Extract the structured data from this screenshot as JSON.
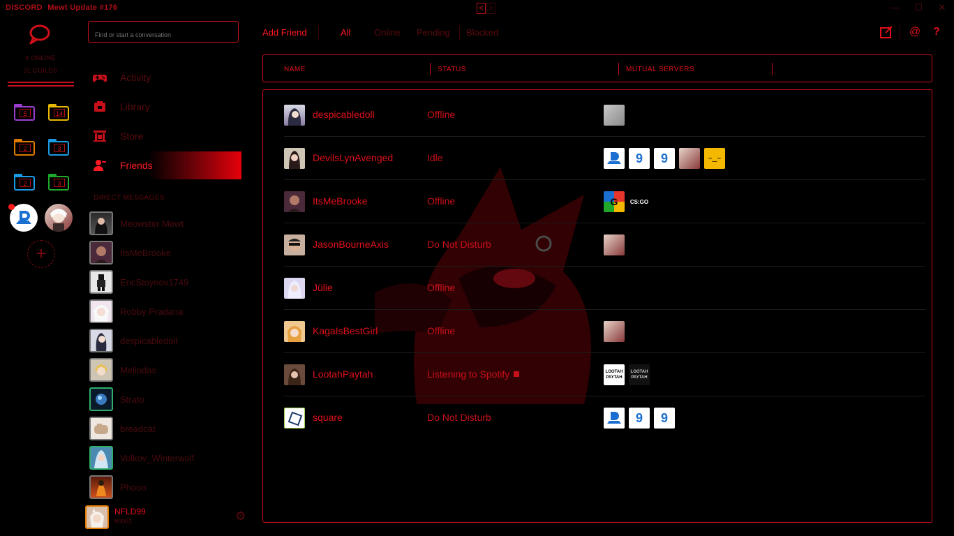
{
  "titlebar": {
    "logo": "DISCORD",
    "title": "Mewt Update #176",
    "back": "<",
    "forward": ">",
    "minimize": "—",
    "maximize": "☐",
    "close": "✕"
  },
  "guilds": {
    "online": "4 ONLINE",
    "guild_count": "31 GUILDS",
    "folders": [
      {
        "count": "5",
        "color": "#9b3fd1"
      },
      {
        "count": "14",
        "color": "#e6b800"
      },
      {
        "count": "2",
        "color": "#e07b00"
      },
      {
        "count": "3",
        "color": "#1a9be6"
      },
      {
        "count": "2",
        "color": "#1a9be6"
      },
      {
        "count": "3",
        "color": "#1fa82a"
      }
    ],
    "add": "+"
  },
  "channels": {
    "search_placeholder": "Find or start a conversation",
    "nav": [
      {
        "label": "Activity",
        "icon": "gamepad-icon"
      },
      {
        "label": "Library",
        "icon": "library-icon"
      },
      {
        "label": "Store",
        "icon": "store-icon"
      },
      {
        "label": "Friends",
        "icon": "friends-icon"
      }
    ],
    "dm_header": "DIRECT MESSAGES",
    "dms": [
      {
        "name": "Meowster Mewt"
      },
      {
        "name": "ItsMeBrooke"
      },
      {
        "name": "EricStoynov1749"
      },
      {
        "name": "Robby Pradana"
      },
      {
        "name": "despicabledoll"
      },
      {
        "name": "Meliodas"
      },
      {
        "name": "Strato"
      },
      {
        "name": "breadcat"
      },
      {
        "name": "Volkov_Winterwolf"
      },
      {
        "name": "Phoon"
      }
    ],
    "user": {
      "name": "NFLD99",
      "tag": "#0001"
    }
  },
  "topbar": {
    "add_friend": "Add Friend",
    "tabs": [
      "All",
      "Online",
      "Pending",
      "Blocked"
    ],
    "icons": [
      "new-group-icon",
      "mention-icon",
      "help-icon"
    ],
    "mention": "@",
    "help": "?"
  },
  "columns": {
    "name": "NAME",
    "status": "STATUS",
    "mutual": "MUTUAL SERVERS"
  },
  "friends": [
    {
      "name": "despicabledoll",
      "status": "Offline",
      "servers": [
        "photo"
      ]
    },
    {
      "name": "DevilsLynAvenged",
      "status": "Idle",
      "servers": [
        "blue-d",
        "nine",
        "nine",
        "anime",
        "smile"
      ]
    },
    {
      "name": "ItsMeBrooke",
      "status": "Offline",
      "servers": [
        "google",
        "csgo"
      ]
    },
    {
      "name": "JasonBourneAxis",
      "status": "Do Not Disturb",
      "servers": [
        "anime"
      ]
    },
    {
      "name": "Jülie",
      "status": "Offline",
      "servers": []
    },
    {
      "name": "KagaIsBestGirl",
      "status": "Offline",
      "servers": [
        "anime"
      ]
    },
    {
      "name": "LootahPaytah",
      "status": "Listening to Spotify",
      "servers": [
        "lootah-light",
        "lootah-dark"
      ]
    },
    {
      "name": "square",
      "status": "Do Not Disturb",
      "servers": [
        "blue-d",
        "nine",
        "nine"
      ]
    }
  ],
  "server_labels": {
    "csgo": "CS:GO",
    "google": "G",
    "nine": "9",
    "blue-d": "D",
    "smile": "~‿~",
    "lootah": "LOOTAH PAYTAH"
  },
  "colors": {
    "accent": "#e0101a",
    "dim": "#5a0a0e",
    "background": "#000000"
  }
}
